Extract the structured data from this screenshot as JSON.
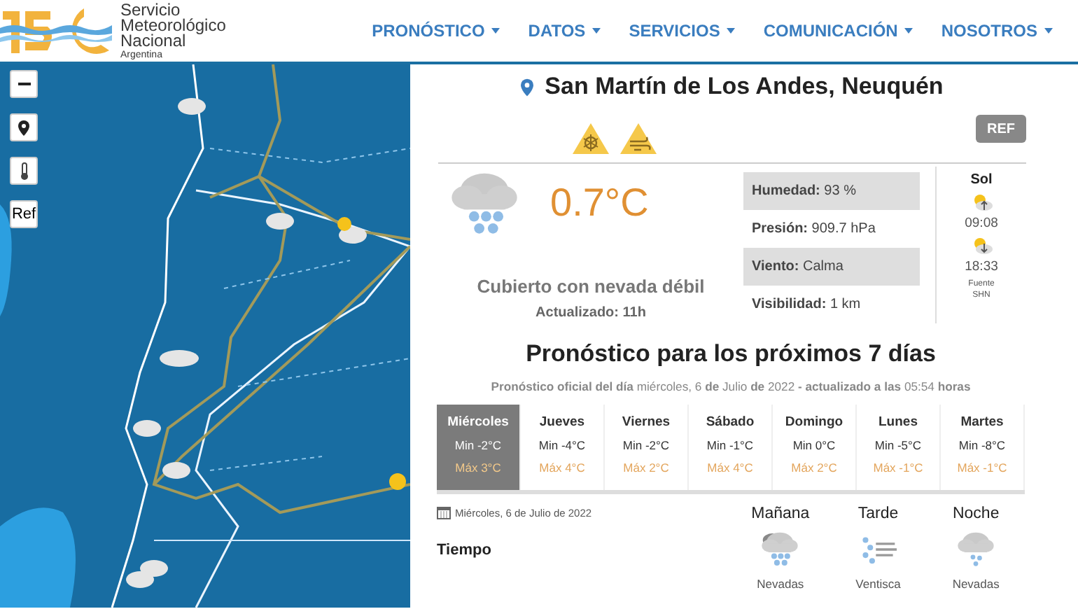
{
  "header": {
    "logo_lines": [
      "Servicio",
      "Meteorológico",
      "Nacional"
    ],
    "logo_country": "Argentina"
  },
  "nav": [
    {
      "label": "PRONÓSTICO"
    },
    {
      "label": "DATOS"
    },
    {
      "label": "SERVICIOS"
    },
    {
      "label": "COMUNICACIÓN"
    },
    {
      "label": "NOSOTROS"
    }
  ],
  "map": {
    "kind": "picture",
    "controls": [
      {
        "kind": "zoom-out"
      },
      {
        "kind": "pin"
      },
      {
        "kind": "thermometer"
      },
      {
        "kind": "text",
        "label": "Ref"
      }
    ]
  },
  "current": {
    "location": "San Martín de Los Andes, Neuquén",
    "alerts": [
      {
        "kind": "snow"
      },
      {
        "kind": "wind"
      }
    ],
    "ref_button": "REF",
    "temperature": "0.7°C",
    "description": "Cubierto con nevada débil",
    "updated": "Actualizado: 11h",
    "readings": [
      "**Humedad:** 93 %",
      "**Presión:** 909.7 hPa",
      "**Viento:** Calma",
      "**Visibilidad:** 1 km"
    ],
    "sun": {
      "title": "Sol",
      "sunrise": "09:08",
      "sunset": "18:33",
      "source": "Fuente SHN"
    }
  },
  "forecast": {
    "title": "Pronóstico para los próximos 7 días",
    "subtitle": "**Pronóstico oficial del día** miércoles, 6 **de** Julio **de** 2022 **- actualizado a las** 05:54 **horas**",
    "days": [
      {
        "day": "Miércoles",
        "min": "Min -2°C",
        "max": "Máx 3°C",
        "selected": true
      },
      {
        "day": "Jueves",
        "min": "Min -4°C",
        "max": "Máx 4°C",
        "selected": false
      },
      {
        "day": "Viernes",
        "min": "Min -2°C",
        "max": "Máx 2°C",
        "selected": false
      },
      {
        "day": "Sábado",
        "min": "Min -1°C",
        "max": "Máx 4°C",
        "selected": false
      },
      {
        "day": "Domingo",
        "min": "Min 0°C",
        "max": "Máx 2°C",
        "selected": false
      },
      {
        "day": "Lunes",
        "min": "Min -5°C",
        "max": "Máx -1°C",
        "selected": false
      },
      {
        "day": "Martes",
        "min": "Min -8°C",
        "max": "Máx -1°C",
        "selected": false
      }
    ]
  },
  "detail": {
    "date": "Miércoles, 6 de Julio de 2022",
    "row_label": "Tiempo",
    "periods": [
      {
        "label": "Mañana",
        "condition": "Nevadas",
        "kind": "heavy-snow"
      },
      {
        "label": "Tarde",
        "condition": "Ventisca",
        "kind": "blizzard"
      },
      {
        "label": "Noche",
        "condition": "Nevadas",
        "kind": "snow"
      }
    ]
  }
}
